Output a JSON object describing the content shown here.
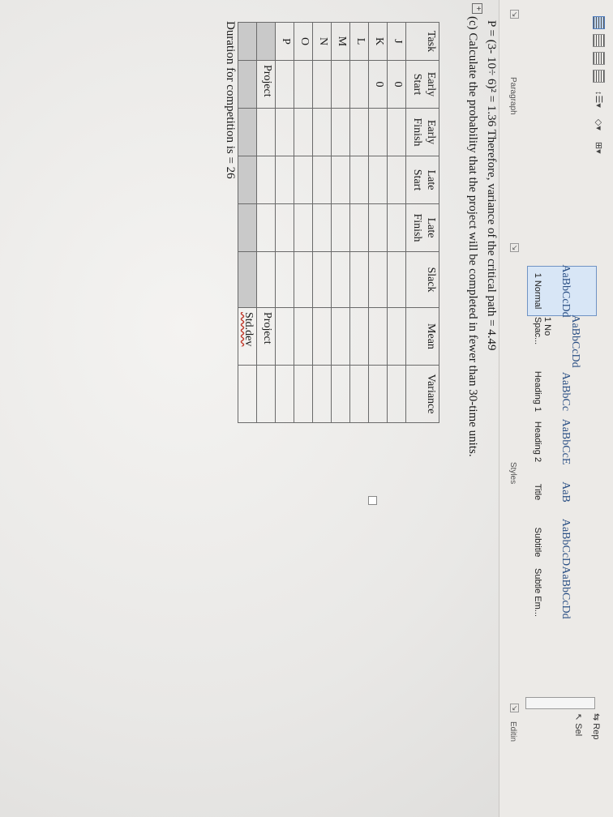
{
  "ribbon": {
    "paragraph_label": "Paragraph",
    "styles_label": "Styles",
    "edit_label": "Editin",
    "styles": [
      {
        "sample": "AaBbCcDd",
        "name": "1 Normal"
      },
      {
        "sample": "AaBbCcDd",
        "name": "1 No Spac..."
      },
      {
        "sample": "AaBbCc",
        "name": "Heading 1"
      },
      {
        "sample": "AaBbCcE",
        "name": "Heading 2"
      },
      {
        "sample": "AaB",
        "name": "Title"
      },
      {
        "sample": "AaBbCcD",
        "name": "Subtitle"
      },
      {
        "sample": "AaBbCcDd",
        "name": "Subtle Em..."
      }
    ],
    "replace_label": "Rep",
    "select_label": "Sel"
  },
  "doc": {
    "line1": "P = (3- 10÷ 6)² = 1.36 Therefore, variance of the critical path = 4.49",
    "line2": "(c) Calculate the probability that the project will be completed in fewer than 30-time units.",
    "headers": [
      "Task",
      "Early\nStart",
      "Early\nFinish",
      "Late\nStart",
      "Late\nFinish",
      "Slack",
      "Mean",
      "Variance"
    ],
    "rows": [
      [
        "J",
        "0",
        "",
        "",
        "",
        "",
        "",
        ""
      ],
      [
        "K",
        "0",
        "",
        "",
        "",
        "",
        "",
        ""
      ],
      [
        "L",
        "",
        "",
        "",
        "",
        "",
        "",
        ""
      ],
      [
        "M",
        "",
        "",
        "",
        "",
        "",
        "",
        ""
      ],
      [
        "N",
        "",
        "",
        "",
        "",
        "",
        "",
        ""
      ],
      [
        "O",
        "",
        "",
        "",
        "",
        "",
        "",
        ""
      ],
      [
        "P",
        "",
        "",
        "",
        "",
        "",
        "",
        ""
      ]
    ],
    "project_label": "Project",
    "project_label2": "Project",
    "std_dev_label": "Std.dev",
    "duration": "Duration for competition is = 26"
  }
}
